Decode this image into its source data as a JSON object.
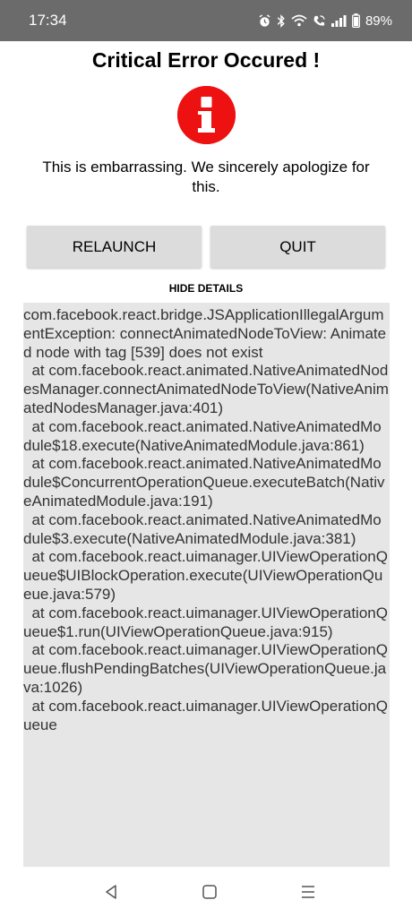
{
  "status_bar": {
    "time": "17:34",
    "battery_percent": "89%",
    "icons": [
      "alarm-icon",
      "bluetooth-icon",
      "wifi-icon",
      "wifi-call-icon",
      "signal-icon",
      "battery-icon"
    ]
  },
  "dialog": {
    "title": "Critical Error Occured !",
    "icon": "info-icon",
    "message": "This is embarrassing. We sincerely apologize for this.",
    "relaunch_label": "RELAUNCH",
    "quit_label": "QUIT",
    "hide_details_label": "HIDE DETAILS",
    "details_text": "com.facebook.react.bridge.JSApplicationIllegalArgumentException: connectAnimatedNodeToView: Animated node with tag [539] does not exist\n  at com.facebook.react.animated.NativeAnimatedNodesManager.connectAnimatedNodeToView(NativeAnimatedNodesManager.java:401)\n  at com.facebook.react.animated.NativeAnimatedModule$18.execute(NativeAnimatedModule.java:861)\n  at com.facebook.react.animated.NativeAnimatedModule$ConcurrentOperationQueue.executeBatch(NativeAnimatedModule.java:191)\n  at com.facebook.react.animated.NativeAnimatedModule$3.execute(NativeAnimatedModule.java:381)\n  at com.facebook.react.uimanager.UIViewOperationQueue$UIBlockOperation.execute(UIViewOperationQueue.java:579)\n  at com.facebook.react.uimanager.UIViewOperationQueue$1.run(UIViewOperationQueue.java:915)\n  at com.facebook.react.uimanager.UIViewOperationQueue.flushPendingBatches(UIViewOperationQueue.java:1026)\n  at com.facebook.react.uimanager.UIViewOperationQueue"
  },
  "colors": {
    "status_bar_bg": "#6b6b6b",
    "error_red": "#ee1111",
    "button_bg": "#dcdcdc",
    "details_bg": "#e6e6e6"
  },
  "nav_bar": {
    "icons": [
      "back-icon",
      "home-icon",
      "recents-icon"
    ]
  }
}
